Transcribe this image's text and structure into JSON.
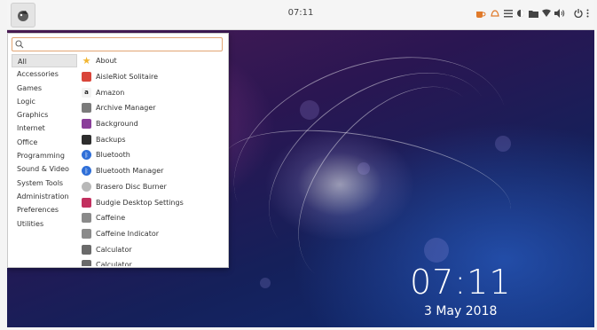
{
  "panel": {
    "clock": "07:11",
    "tray_icons": [
      "caffeine-icon",
      "notifications-icon",
      "menu-icon",
      "display-icon",
      "folder-icon",
      "wifi-icon",
      "volume-icon",
      "power-icon"
    ]
  },
  "menu": {
    "search_placeholder": "",
    "categories": [
      "All",
      "Accessories",
      "Games",
      "Logic",
      "Graphics",
      "Internet",
      "Office",
      "Programming",
      "Sound & Video",
      "System Tools",
      "Administration",
      "Preferences",
      "Utilities"
    ],
    "active_category": "All",
    "apps": [
      {
        "label": "About",
        "icon": "star-icon",
        "color": "#f2b632"
      },
      {
        "label": "AisleRiot Solitaire",
        "icon": "cards-icon",
        "color": "#d9453a"
      },
      {
        "label": "Amazon",
        "icon": "amazon-icon",
        "color": "#f3f3f3"
      },
      {
        "label": "Archive Manager",
        "icon": "archive-icon",
        "color": "#7b7b7b"
      },
      {
        "label": "Background",
        "icon": "background-icon",
        "color": "#8a3e9a"
      },
      {
        "label": "Backups",
        "icon": "backups-icon",
        "color": "#2d2d2d"
      },
      {
        "label": "Bluetooth",
        "icon": "bluetooth-icon",
        "color": "#2f6fd8"
      },
      {
        "label": "Bluetooth Manager",
        "icon": "bluetooth-manager-icon",
        "color": "#2f6fd8"
      },
      {
        "label": "Brasero Disc Burner",
        "icon": "disc-icon",
        "color": "#b8b8b8"
      },
      {
        "label": "Budgie Desktop Settings",
        "icon": "settings-icon",
        "color": "#c2305f"
      },
      {
        "label": "Caffeine",
        "icon": "cup-icon",
        "color": "#8a8a8a"
      },
      {
        "label": "Caffeine Indicator",
        "icon": "cup-indicator-icon",
        "color": "#8a8a8a"
      },
      {
        "label": "Calculator",
        "icon": "calculator-icon",
        "color": "#6a6a6a"
      },
      {
        "label": "Calculator",
        "icon": "calculator-icon",
        "color": "#6a6a6a"
      }
    ]
  },
  "desktop": {
    "time": "07:11",
    "date": "3 May 2018"
  },
  "colors": {
    "panel_bg": "#f5f5f5",
    "search_border": "#e2a574",
    "active_category_bg": "#e6e6e6"
  }
}
